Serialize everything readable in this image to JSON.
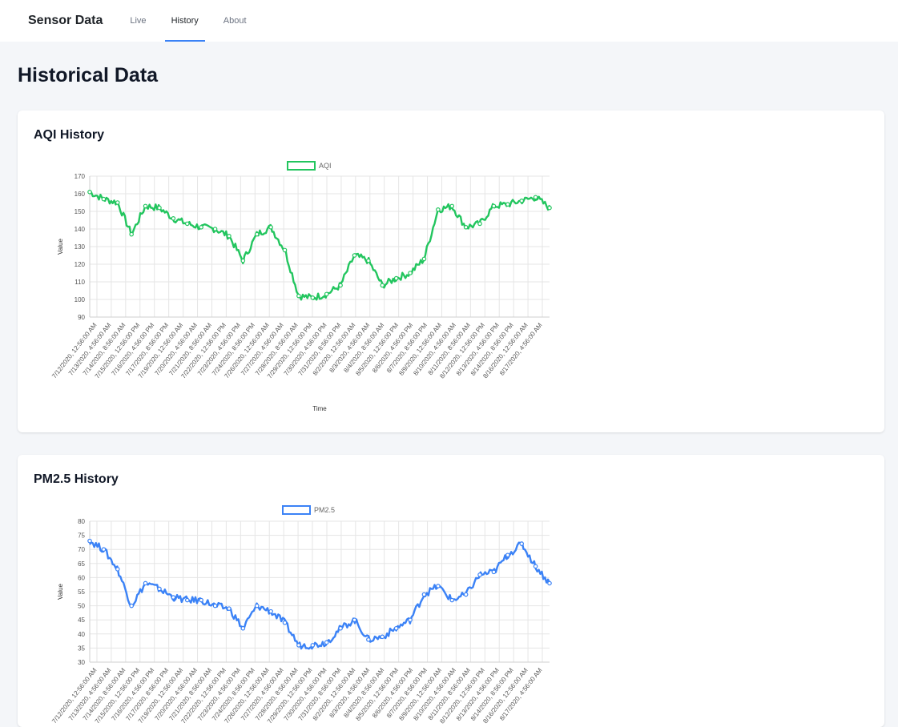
{
  "app": {
    "brand": "Sensor Data",
    "nav": [
      {
        "label": "Live",
        "active": false
      },
      {
        "label": "History",
        "active": true
      },
      {
        "label": "About",
        "active": false
      }
    ]
  },
  "page": {
    "title": "Historical Data"
  },
  "charts": {
    "aqi": {
      "title": "AQI History"
    },
    "pm25": {
      "title": "PM2.5 History"
    }
  },
  "chart_data": [
    {
      "type": "line",
      "title": "",
      "xlabel": "Time",
      "ylabel": "Value",
      "ylim": [
        90,
        170
      ],
      "yticks": [
        90,
        100,
        110,
        120,
        130,
        140,
        150,
        160,
        170
      ],
      "grid": true,
      "legend_position": "top",
      "color": "#22c55e",
      "x": [
        "7/12/2020, 12:56:00 AM",
        "7/13/2020, 4:56:00 AM",
        "7/14/2020, 8:56:00 AM",
        "7/15/2020, 12:56:00 PM",
        "7/16/2020, 4:56:00 PM",
        "7/17/2020, 8:56:00 PM",
        "7/19/2020, 12:56:00 AM",
        "7/20/2020, 4:56:00 AM",
        "7/21/2020, 8:56:00 AM",
        "7/22/2020, 12:56:00 PM",
        "7/23/2020, 4:56:00 PM",
        "7/24/2020, 8:56:00 PM",
        "7/26/2020, 12:56:00 AM",
        "7/27/2020, 4:56:00 AM",
        "7/28/2020, 8:56:00 AM",
        "7/29/2020, 12:56:00 PM",
        "7/30/2020, 4:56:00 PM",
        "7/31/2020, 8:56:00 PM",
        "8/2/2020, 12:56:00 AM",
        "8/3/2020, 4:56:00 AM",
        "8/4/2020, 8:56:00 AM",
        "8/5/2020, 12:56:00 PM",
        "8/6/2020, 4:56:00 PM",
        "8/7/2020, 8:56:00 PM",
        "8/9/2020, 12:56:00 AM",
        "8/10/2020, 4:56:00 AM",
        "8/11/2020, 8:56:00 AM",
        "8/12/2020, 12:56:00 PM",
        "8/13/2020, 4:56:00 PM",
        "8/14/2020, 8:56:00 PM",
        "8/16/2020, 12:56:00 AM",
        "8/17/2020, 4:56:00 AM"
      ],
      "series": [
        {
          "name": "AQI",
          "values": [
            161,
            157,
            155,
            137,
            153,
            152,
            146,
            143,
            141,
            140,
            136,
            122,
            137,
            141,
            128,
            102,
            101,
            103,
            108,
            125,
            122,
            108,
            112,
            115,
            123,
            151,
            153,
            141,
            143,
            153,
            154,
            156,
            158,
            152
          ]
        }
      ]
    },
    {
      "type": "line",
      "title": "",
      "xlabel": "Time",
      "ylabel": "Value",
      "ylim": [
        30,
        80
      ],
      "yticks": [
        30,
        35,
        40,
        45,
        50,
        55,
        60,
        65,
        70,
        75,
        80
      ],
      "grid": true,
      "legend_position": "top",
      "color": "#3b82f6",
      "x": [
        "7/12/2020, 12:56:00 AM",
        "7/13/2020, 4:56:00 AM",
        "7/14/2020, 8:56:00 AM",
        "7/15/2020, 12:56:00 PM",
        "7/16/2020, 4:56:00 PM",
        "7/17/2020, 8:56:00 PM",
        "7/19/2020, 12:56:00 AM",
        "7/20/2020, 4:56:00 AM",
        "7/21/2020, 8:56:00 AM",
        "7/22/2020, 12:56:00 PM",
        "7/23/2020, 4:56:00 PM",
        "7/24/2020, 8:56:00 PM",
        "7/26/2020, 12:56:00 AM",
        "7/27/2020, 4:56:00 AM",
        "7/28/2020, 8:56:00 AM",
        "7/29/2020, 12:56:00 PM",
        "7/30/2020, 4:56:00 PM",
        "7/31/2020, 8:56:00 PM",
        "8/2/2020, 12:56:00 AM",
        "8/3/2020, 4:56:00 AM",
        "8/4/2020, 8:56:00 AM",
        "8/5/2020, 12:56:00 PM",
        "8/6/2020, 4:56:00 PM",
        "8/7/2020, 8:56:00 PM",
        "8/9/2020, 12:56:00 AM",
        "8/10/2020, 4:56:00 AM",
        "8/11/2020, 8:56:00 AM",
        "8/12/2020, 12:56:00 PM",
        "8/13/2020, 4:56:00 PM",
        "8/14/2020, 8:56:00 PM",
        "8/16/2020, 12:56:00 AM",
        "8/17/2020, 4:56:00 AM"
      ],
      "series": [
        {
          "name": "PM2.5",
          "values": [
            73,
            70,
            63,
            50,
            58,
            56,
            53,
            52,
            52,
            50,
            49,
            42,
            50,
            48,
            44,
            36,
            36,
            37,
            42,
            45,
            38,
            39,
            42,
            45,
            54,
            57,
            52,
            54,
            61,
            62,
            68,
            72,
            64,
            58
          ]
        }
      ]
    }
  ]
}
